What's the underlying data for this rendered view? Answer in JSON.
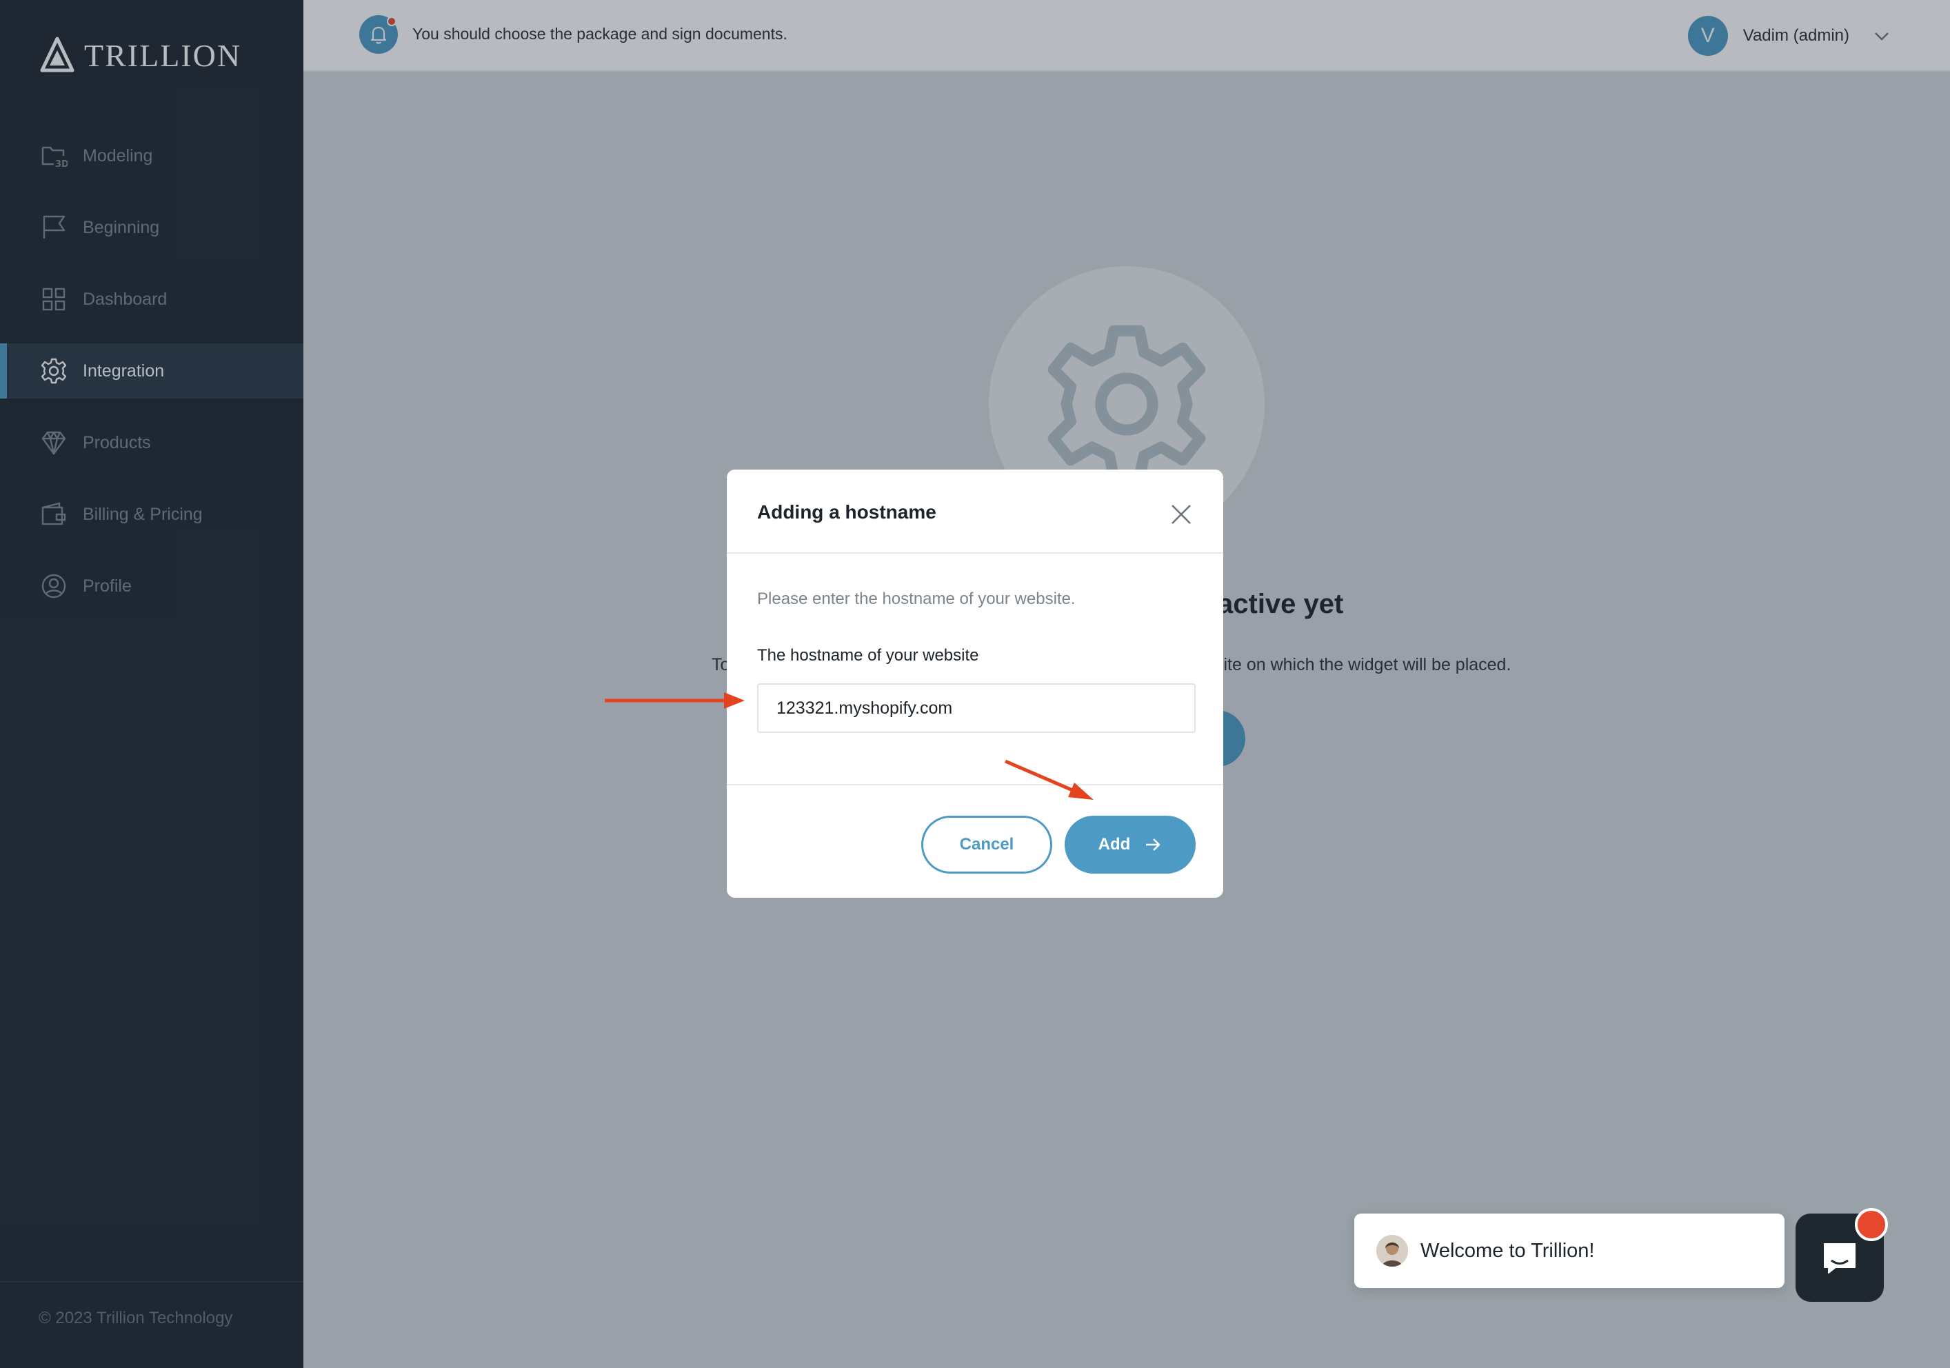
{
  "app": {
    "logo_text": "TRILLION",
    "copyright": "© 2023 Trillion Technology"
  },
  "sidebar": {
    "items": [
      {
        "label": "Modeling",
        "icon": "modeling-3d-icon",
        "active": false
      },
      {
        "label": "Beginning",
        "icon": "flag-icon",
        "active": false
      },
      {
        "label": "Dashboard",
        "icon": "grid-icon",
        "active": false
      },
      {
        "label": "Integration",
        "icon": "gear-icon",
        "active": true
      },
      {
        "label": "Products",
        "icon": "diamond-icon",
        "active": false
      },
      {
        "label": "Billing & Pricing",
        "icon": "wallet-icon",
        "active": false
      },
      {
        "label": "Profile",
        "icon": "user-circle-icon",
        "active": false
      }
    ]
  },
  "header": {
    "notice": "You should choose the package and sign documents.",
    "user_initial": "V",
    "user_name": "Vadim (admin)"
  },
  "main": {
    "empty_title_visible": "active yet",
    "empty_desc_left": "To",
    "empty_desc_right": "site on which the widget will be placed."
  },
  "modal": {
    "title": "Adding a hostname",
    "hint": "Please enter the hostname of your website.",
    "field_label": "The hostname of your website",
    "field_value": "123321.myshopify.com",
    "cancel_label": "Cancel",
    "add_label": "Add"
  },
  "chat": {
    "welcome": "Welcome to Trillion!"
  },
  "colors": {
    "accent": "#4d9ac4",
    "sidebar_bg": "#1f272f",
    "alert": "#e6482f",
    "annotation_arrow": "#e3431f"
  }
}
